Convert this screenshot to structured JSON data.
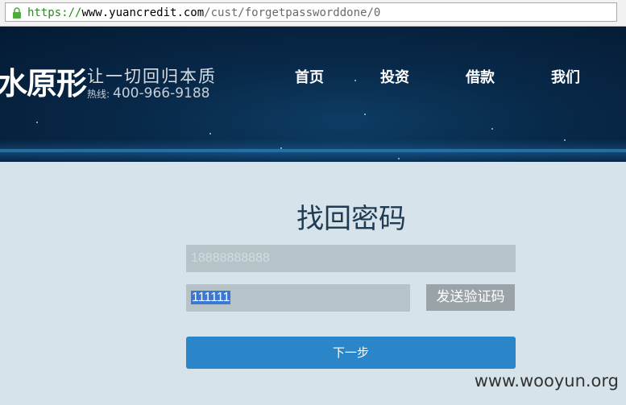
{
  "browser": {
    "url_scheme": "https://",
    "url_host": "www.yuancredit.com",
    "url_path": "/cust/forgetpassworddone/0"
  },
  "header": {
    "logo_text": "水原形",
    "slogan": "让一切回归本质",
    "hotline_label": "热线:",
    "hotline_number": "400-966-9188",
    "nav": [
      "首页",
      "投资",
      "借款",
      "我们"
    ]
  },
  "form": {
    "title": "找回密码",
    "phone_value": "18888888888",
    "code_value": "111111",
    "send_code_label": "发送验证码",
    "next_label": "下一步"
  },
  "watermark": "www.wooyun.org",
  "colors": {
    "header_bg": "#082848",
    "page_bg": "#d7e3ea",
    "field_bg": "#b6c3c9",
    "primary_button": "#2a86c9",
    "send_button": "#9aa3a7"
  }
}
